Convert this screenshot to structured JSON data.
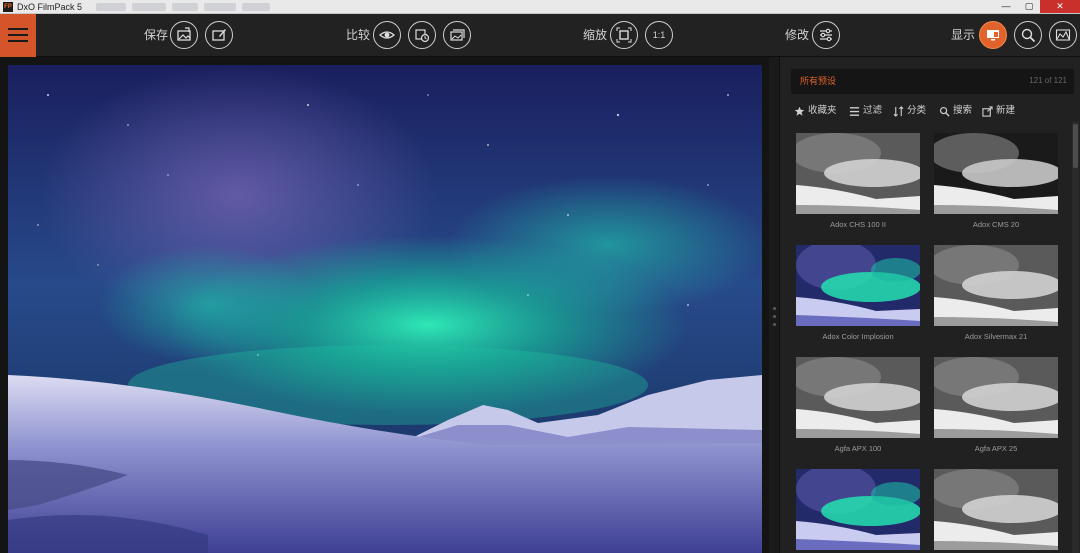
{
  "window": {
    "logo_text": "FP",
    "title": "DxO FilmPack 5",
    "controls": {
      "minimize": "—",
      "maximize": "▢",
      "close": "✕"
    }
  },
  "toolbar": {
    "save_label": "保存",
    "compare_label": "比较",
    "zoom_label": "缩放",
    "zoom_one_to_one": "1:1",
    "edit_label": "修改",
    "display_label": "显示"
  },
  "colors": {
    "accent": "#e2622c",
    "menu_button": "#d4552a",
    "panel_bg": "#212121",
    "toolbar_bg": "#222222"
  },
  "icons": {
    "menu": "hamburger-icon",
    "export_image": "export-image-icon",
    "edit_image": "edit-image-icon",
    "compare_eye": "eye-icon",
    "history": "history-icon",
    "gallery": "gallery-icon",
    "fit": "fit-screen-icon",
    "adjust": "sliders-icon",
    "monitor": "monitor-icon",
    "zoom_search": "magnifier-icon",
    "histogram": "histogram-icon"
  },
  "panel": {
    "category": "所有预设",
    "count": "121 of 121",
    "actions": {
      "favorites": "收藏夹",
      "filter": "过滤",
      "sort": "分类",
      "search": "搜索",
      "new": "新建"
    },
    "presets": [
      {
        "label": "Adox CHS 100 II",
        "style": "bw"
      },
      {
        "label": "Adox CMS 20",
        "style": "bw-contrast"
      },
      {
        "label": "Adox Color Implosion",
        "style": "color"
      },
      {
        "label": "Adox Silvermax 21",
        "style": "bw"
      },
      {
        "label": "Agfa APX 100",
        "style": "bw"
      },
      {
        "label": "Agfa APX 25",
        "style": "bw"
      },
      {
        "label": "",
        "style": "color"
      },
      {
        "label": "",
        "style": "bw"
      }
    ]
  }
}
